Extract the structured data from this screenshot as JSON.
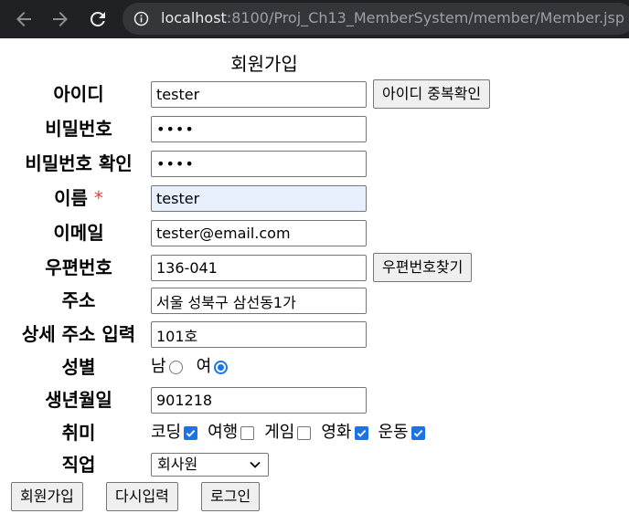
{
  "browser": {
    "url_host": "localhost",
    "url_path": ":8100/Proj_Ch13_MemberSystem/member/Member.jsp",
    "icons": [
      "back-arrow-icon",
      "forward-arrow-icon",
      "reload-icon",
      "info-icon"
    ]
  },
  "form": {
    "title": "회원가입",
    "id": {
      "label": "아이디",
      "value": "tester",
      "check_button": "아이디 중복확인"
    },
    "password": {
      "label": "비밀번호",
      "value": "••••"
    },
    "password_confirm": {
      "label": "비밀번호 확인",
      "value": "••••"
    },
    "name": {
      "label": "이름",
      "required_mark": "*",
      "value": "tester"
    },
    "email": {
      "label": "이메일",
      "value": "tester@email.com"
    },
    "zipcode": {
      "label": "우편번호",
      "value": "136-041",
      "search_button": "우편번호찾기"
    },
    "address": {
      "label": "주소",
      "value": "서울 성북구 삼선동1가"
    },
    "address_detail": {
      "label": "상세 주소 입력",
      "value": "101호"
    },
    "gender": {
      "label": "성별",
      "options": [
        {
          "label": "남",
          "selected": false
        },
        {
          "label": "여",
          "selected": true
        }
      ]
    },
    "birthday": {
      "label": "생년월일",
      "value": "901218"
    },
    "hobby": {
      "label": "취미",
      "options": [
        {
          "label": "코딩",
          "checked": true
        },
        {
          "label": "여행",
          "checked": false
        },
        {
          "label": "게임",
          "checked": false
        },
        {
          "label": "영화",
          "checked": true
        },
        {
          "label": "운동",
          "checked": true
        }
      ]
    },
    "job": {
      "label": "직업",
      "selected": "회사원"
    },
    "buttons": {
      "submit": "회원가입",
      "reset": "다시입력",
      "login": "로그인"
    }
  },
  "colors": {
    "accent": "#1a73e8",
    "required": "#e0413f",
    "autofill": "#e8f0fe",
    "browser_bar": "#202124"
  }
}
